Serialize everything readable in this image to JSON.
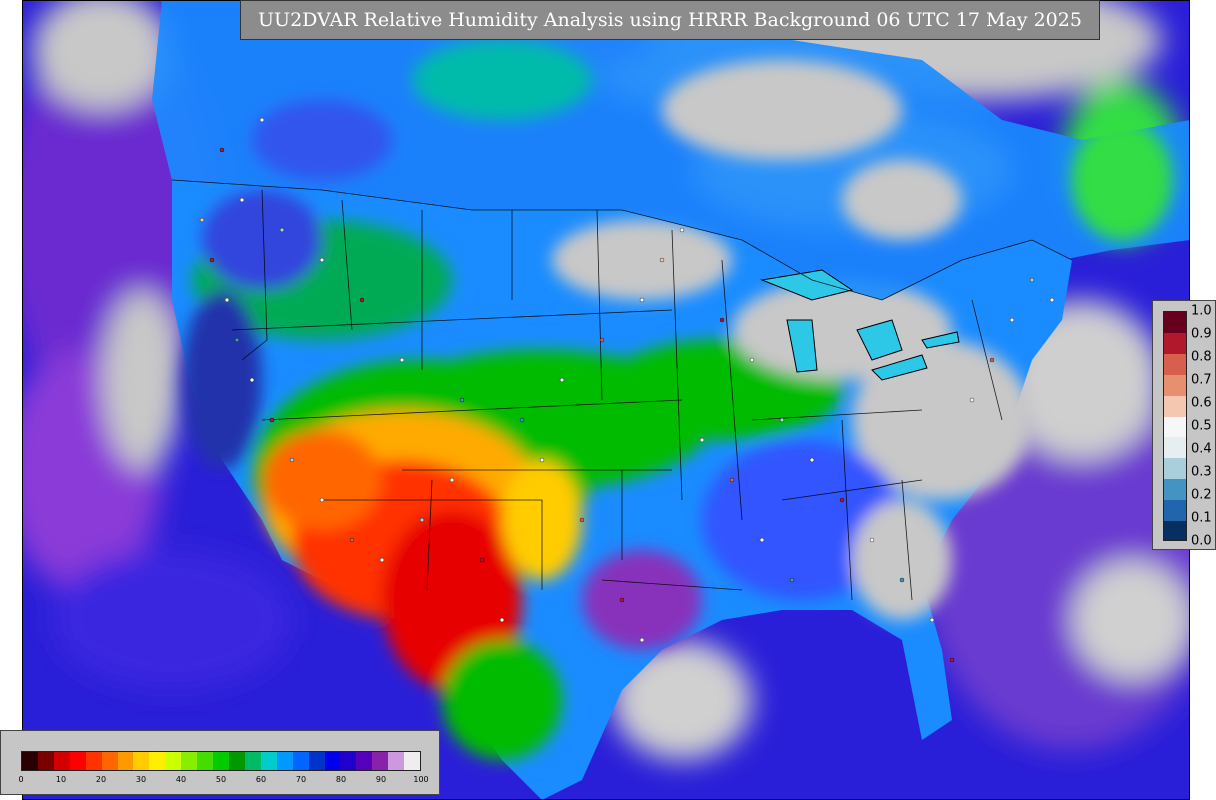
{
  "title": "UU2DVAR Relative Humidity Analysis using HRRR Background 06 UTC 17 May 2025",
  "increment_colorbar": {
    "tick_labels": [
      "1.0",
      "0.9",
      "0.8",
      "0.7",
      "0.6",
      "0.5",
      "0.4",
      "0.3",
      "0.2",
      "0.1",
      "0.0"
    ],
    "colors": [
      "#67001f",
      "#b2182b",
      "#d6604d",
      "#e69070",
      "#f4c7b0",
      "#f7f7f7",
      "#e6eef2",
      "#a9cfdc",
      "#4393c3",
      "#2166ac",
      "#053061"
    ]
  },
  "rh_colorbar": {
    "tick_labels": [
      "0",
      "10",
      "20",
      "30",
      "40",
      "50",
      "60",
      "70",
      "80",
      "90",
      "100"
    ],
    "colors": [
      "#2a0000",
      "#7a0000",
      "#d40000",
      "#ff0000",
      "#ff3300",
      "#ff6600",
      "#ff9900",
      "#ffcc00",
      "#ffee00",
      "#ccff00",
      "#88ee00",
      "#44dd00",
      "#00cc00",
      "#009900",
      "#00bb66",
      "#00cccc",
      "#0099ff",
      "#0066ff",
      "#0033cc",
      "#0000ee",
      "#2200cc",
      "#5500bb",
      "#8822aa",
      "#cc99dd",
      "#eeeeee"
    ]
  },
  "map_colors": {
    "ocean": "#2a1fd8",
    "land_humid": "#1a8cff",
    "dry_core": "#e60000",
    "moderate": "#00b800",
    "cloud": "#c8c8c8",
    "lakes": "#2dc7e8",
    "border": "#000000"
  }
}
